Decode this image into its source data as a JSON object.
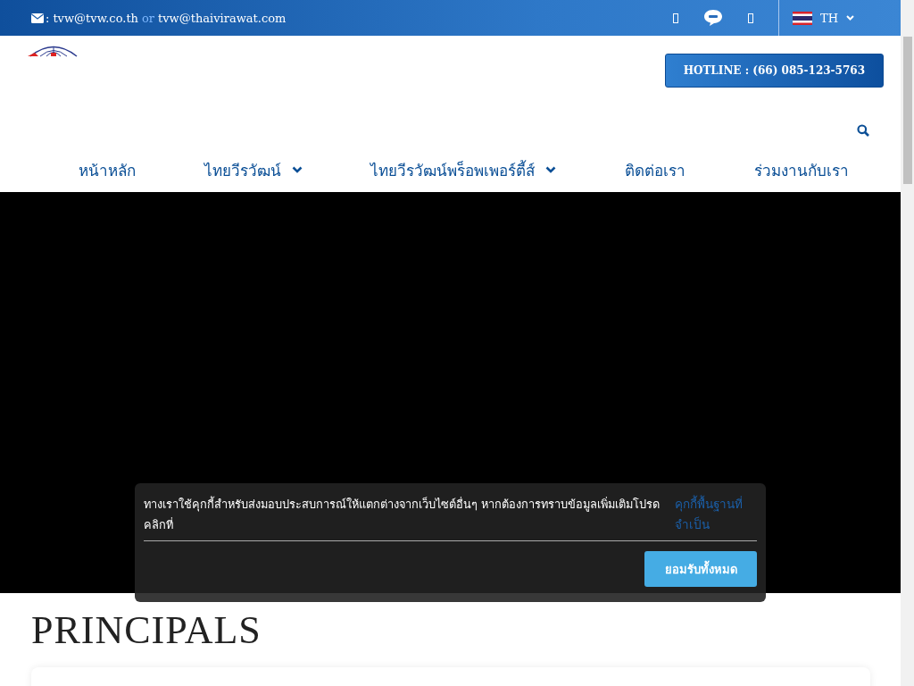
{
  "top_bar": {
    "emails": [
      "tvw@tvw.co.th",
      "tvw@thaivirawat.com"
    ],
    "separator": ": ",
    "or_text": "or",
    "language": "TH"
  },
  "header": {
    "hotline": "HOTLINE : (66) 085-123-5763"
  },
  "nav": [
    {
      "label": "หน้าหลัก",
      "dropdown": false
    },
    {
      "label": "ไทยวีรวัฒน์",
      "dropdown": true
    },
    {
      "label": "ไทยวีรวัฒน์พร็อพเพอร์ตี้ส์",
      "dropdown": true
    },
    {
      "label": "ติดต่อเรา",
      "dropdown": false
    },
    {
      "label": "ร่วมงานกับเรา",
      "dropdown": false
    }
  ],
  "section": {
    "title": "PRINCIPALS"
  },
  "cookie_banner": {
    "message": "ทางเราใช้คุกกี้สำหรับส่งมอบประสบการณ์ให้แตกต่างจากเว็บไซต์อื่นๆ หากต้องการทราบข้อมูลเพิ่มเติมโปรดคลิกที่",
    "link": "คุกกี้พื้นฐานที่จำเป็น",
    "accept": "ยอมรับทั้งหมด"
  }
}
